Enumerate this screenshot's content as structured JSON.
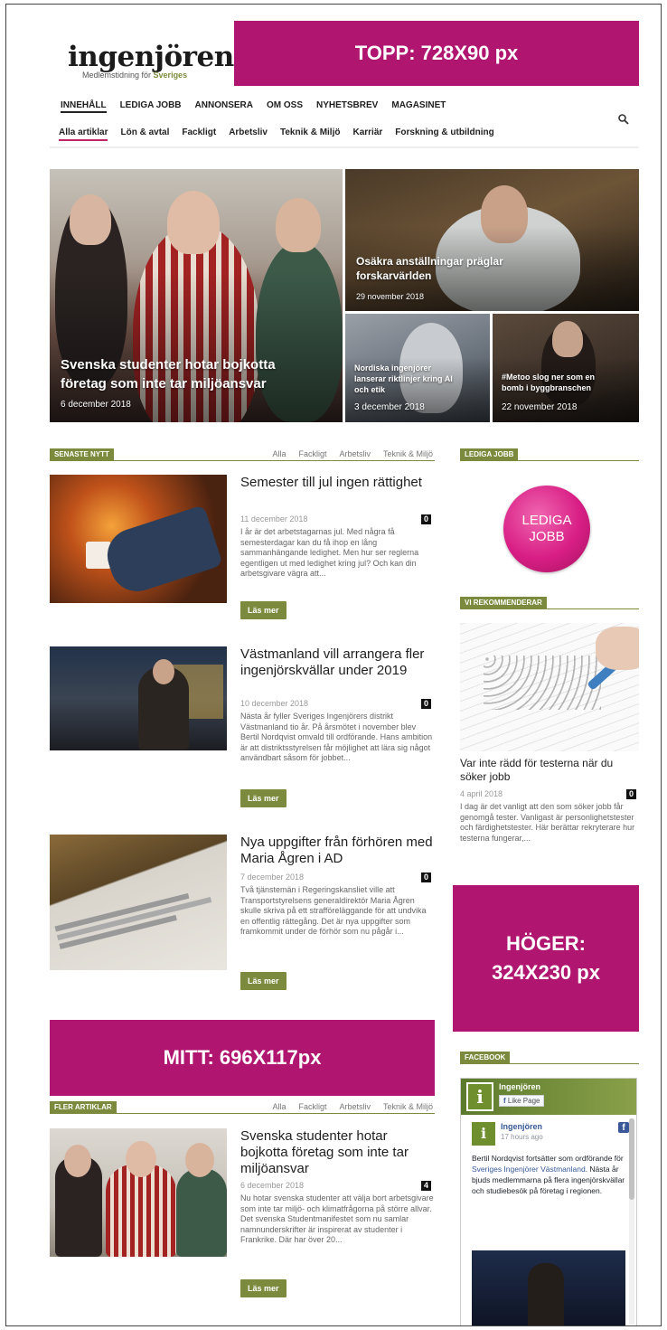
{
  "header": {
    "logo_main": "ingenjören",
    "logo_sub_a": "Medlemstidning för ",
    "logo_sub_b": "Sveriges",
    "ad_top": "TOPP: 728X90 px",
    "main_nav": [
      "INNEHÅLL",
      "LEDIGA JOBB",
      "ANNONSERA",
      "OM OSS",
      "NYHETSBREV",
      "MAGASINET"
    ],
    "sub_nav": [
      "Alla artiklar",
      "Lön & avtal",
      "Fackligt",
      "Arbetsliv",
      "Teknik & Miljö",
      "Karriär",
      "Forskning & utbildning"
    ]
  },
  "hero": {
    "main": {
      "title_1": "Svenska studenter hotar bojkotta",
      "title_2": "företag som inte tar miljöansvar",
      "date": "6 december 2018"
    },
    "top_right": {
      "title_1": "Osäkra anställningar präglar",
      "title_2": "forskarvärlden",
      "date": "29 november 2018"
    },
    "bottom_left": {
      "title_1": "Nordiska ingenjörer",
      "title_2": "lanserar riktlinjer kring AI",
      "title_3": "och etik",
      "date": "3 december 2018"
    },
    "bottom_right": {
      "title_1": "#Metoo slog ner som en",
      "title_2": "bomb i byggbranschen",
      "date": "22 november 2018"
    }
  },
  "latest": {
    "label": "SENASTE NYTT",
    "filters": [
      "Alla",
      "Fackligt",
      "Arbetsliv",
      "Teknik & Miljö"
    ],
    "read_more": "Läs mer",
    "articles": [
      {
        "title": "Semester till jul ingen rättighet",
        "date": "11 december 2018",
        "comments": "0",
        "excerpt": "I år är det arbetstagarnas jul. Med några få semesterdagar kan du få ihop en lång sammanhängande ledighet. Men hur ser reglerna egentligen ut med ledighet kring jul? Och kan din arbetsgivare vägra att..."
      },
      {
        "title": "Västmanland vill arrangera fler ingenjörskvällar under 2019",
        "date": "10 december 2018",
        "comments": "0",
        "excerpt": "Nästa år fyller Sveriges Ingenjörers distrikt Västmanland tio år. På årsmötet i november blev Bertil Nordqvist omvald till ordförande. Hans ambition är att distriktsstyrelsen får möjlighet att lära sig något användbart såsom för jobbet..."
      },
      {
        "title": "Nya uppgifter från förhören med Maria Ågren i AD",
        "date": "7 december 2018",
        "comments": "0",
        "excerpt": "Två tjänstemän i Regeringskansliet ville att Transportstyrelsens generaldirektör Maria Ågren skulle skriva på ett strafföreläggande för att undvika en offentlig rättegång. Det är nya uppgifter som framkommit under de förhör som nu pågår i..."
      }
    ]
  },
  "ad_mid": "MITT: 696X117px",
  "more": {
    "label": "FLER ARTIKLAR",
    "filters": [
      "Alla",
      "Fackligt",
      "Arbetsliv",
      "Teknik & Miljö"
    ],
    "read_more": "Läs mer",
    "article": {
      "title": "Svenska studenter hotar bojkotta företag som inte tar miljöansvar",
      "date": "6 december 2018",
      "comments": "4",
      "excerpt": "Nu hotar svenska studenter att välja bort arbetsgivare som inte tar miljö- och klimatfrågorna på större allvar. Det svenska Studentmanifestet som nu samlar namnunderskrifter är inspirerat av studenter i Frankrike. Där har över 20..."
    }
  },
  "sidebar": {
    "jobs_label": "LEDIGA JOBB",
    "jobs_circle_1": "LEDIGA",
    "jobs_circle_2": "JOBB",
    "recommend_label": "VI REKOMMENDERAR",
    "rec_title": "Var inte rädd för testerna när du söker jobb",
    "rec_date": "4 april 2018",
    "rec_comments": "0",
    "rec_excerpt": "I dag är det vanligt att den som söker jobb får genomgå tester. Vanligast är personlighetstester och färdighetstester. Här berättar rekryterare hur testerna fungerar,...",
    "ad_right_1": "HÖGER:",
    "ad_right_2": "324X230 px",
    "facebook_label": "FACEBOOK",
    "fb_page_name": "Ingenjören",
    "fb_like": "Like Page",
    "fb_post_name": "Ingenjören",
    "fb_post_time": "17 hours ago",
    "fb_text_1": "Bertil Nordqvist fortsätter som ordförande för ",
    "fb_text_link": "Sveriges Ingenjörer Västmanland",
    "fb_text_2": ". Nästa år bjuds medlemmarna på flera ingenjörskvällar och studiebesök på företag i regionen."
  },
  "colors": {
    "accent": "#7b8a3c",
    "ad": "#b0156f",
    "tab_underline": "#c02663",
    "jobs": "#d81e85",
    "facebook": "#3b5998"
  }
}
